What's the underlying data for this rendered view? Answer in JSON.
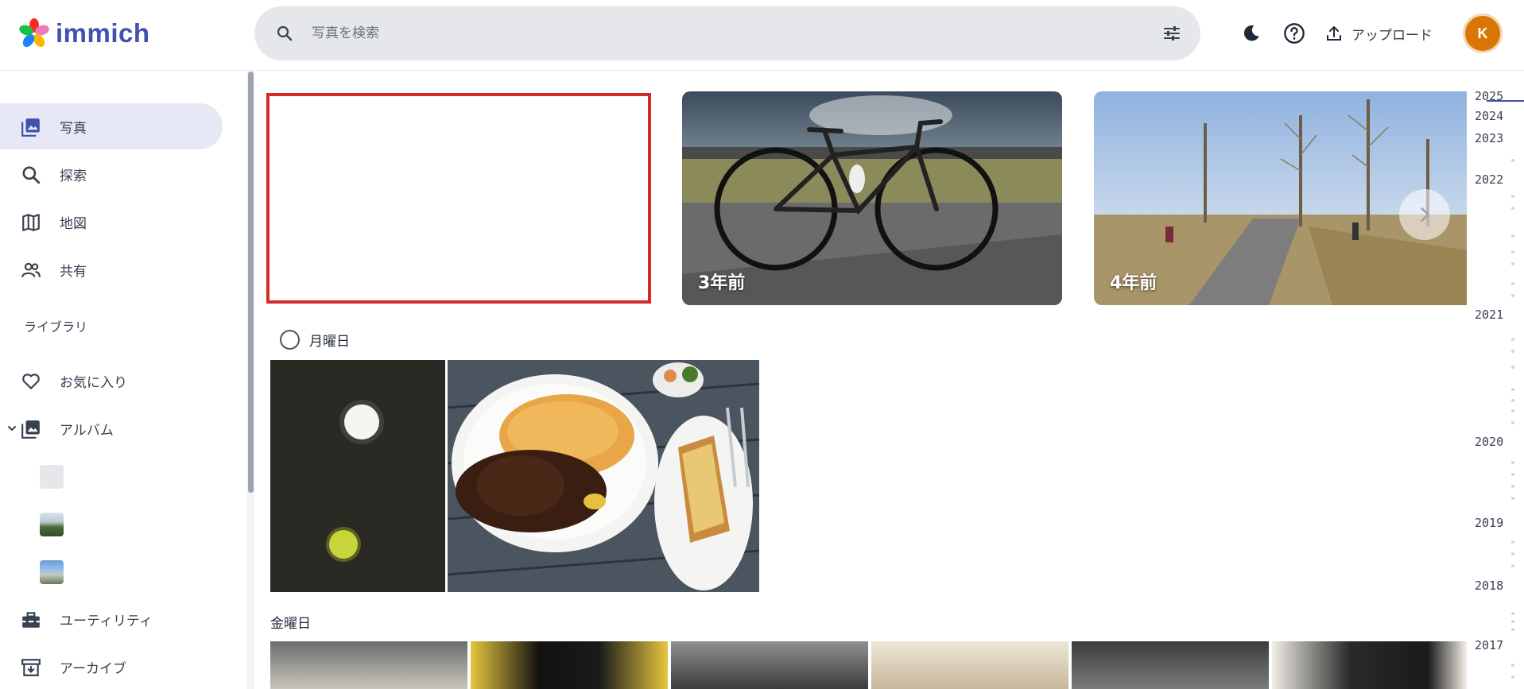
{
  "app": {
    "name": "immich"
  },
  "header": {
    "search_placeholder": "写真を検索",
    "upload_label": "アップロード",
    "avatar_initial": "K",
    "icons": {
      "search": "search-icon",
      "filter": "filter-icon",
      "theme": "moon-icon",
      "help": "help-icon",
      "upload": "upload-icon"
    }
  },
  "sidebar": {
    "items": [
      {
        "label": "写真",
        "icon": "photos-icon",
        "active": true
      },
      {
        "label": "探索",
        "icon": "search-icon",
        "active": false
      },
      {
        "label": "地図",
        "icon": "map-icon",
        "active": false
      },
      {
        "label": "共有",
        "icon": "people-icon",
        "active": false
      }
    ],
    "library_label": "ライブラリ",
    "library_items": [
      {
        "label": "お気に入り",
        "icon": "heart-icon"
      },
      {
        "label": "アルバム",
        "icon": "album-icon"
      }
    ],
    "bottom_items": [
      {
        "label": "ユーティリティ",
        "icon": "toolbox-icon"
      },
      {
        "label": "アーカイブ",
        "icon": "archive-icon"
      }
    ]
  },
  "memories": [
    {
      "label": "3年前"
    },
    {
      "label": "4年前"
    }
  ],
  "days": [
    {
      "label": "月曜日"
    },
    {
      "label": "金曜日"
    }
  ],
  "timeline": {
    "years": [
      "2025",
      "2024",
      "2023",
      "2022",
      "2021",
      "2020",
      "2019",
      "2018",
      "2017"
    ]
  },
  "colors": {
    "brand": "#4250af",
    "avatar": "#d97706",
    "highlight": "#d42a2a"
  }
}
